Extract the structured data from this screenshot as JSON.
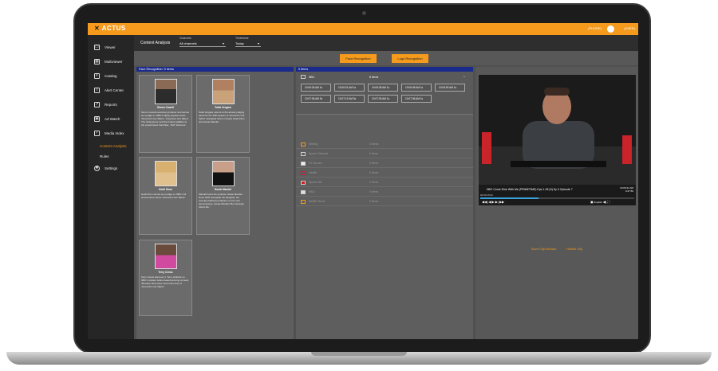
{
  "app": {
    "brand": "ACTUS",
    "phone": "(PHONE)",
    "user": "(USER)"
  },
  "sidebar": {
    "items": [
      {
        "label": "Viewer",
        "icon": "viewer-icon"
      },
      {
        "label": "Multiviewer",
        "icon": "multiviewer-icon"
      },
      {
        "label": "Catalog",
        "icon": "catalog-icon"
      },
      {
        "label": "Alert Center",
        "icon": "bell-icon"
      },
      {
        "label": "Reports",
        "icon": "trend-icon"
      },
      {
        "label": "Ad Watch",
        "icon": "ad-icon"
      },
      {
        "label": "Media Index",
        "icon": "check-icon"
      },
      {
        "label": "Content Analysis",
        "icon": ""
      },
      {
        "label": "Rules",
        "icon": ""
      },
      {
        "label": "Settings",
        "icon": "gear-icon"
      }
    ]
  },
  "header": {
    "title": "Content Analysis",
    "channels_caption": "Channels",
    "channels_value": "All channels",
    "timeframe_caption": "Timeframe",
    "timeframe_value": "Today"
  },
  "buttons": {
    "face": "Face Recognition",
    "logo": "Logo Recognition"
  },
  "faces": {
    "heading": "Face Recognition: 5 items",
    "cards": [
      {
        "name": "Simon Cowell",
        "desc": "Simon Cowell executive producer and serves as a judge on NBC's highly popular series 'America's Got Talent,' 'America's Got Talent: The Champions' and the hottest addition to the powerhouse franchise, 'AGT: Extreme'."
      },
      {
        "name": "Sofía Vergara",
        "desc": "Sofia Vergara returns to the all-star judging panel for the 16th season of 'America's Got Talent' alongside Simon Cowell, Heidi Klum and Howie Mandel."
      },
      {
        "name": "Heidi Klum",
        "desc": "Heidi Klum serves as a judge on NBC's hit summertime series 'America's Got Talent'."
      },
      {
        "name": "Howie Mandel",
        "desc": "Mandel hosts the podcast 'Howie Mandel Does Stuff' alongside his daughter. He recently finished production on his new documentary, 'Howie Mandel: But, Enough About Me.'"
      },
      {
        "name": "Terry Crews",
        "desc": "Terry Crews stars as Lt. Terry Jeffords on NBC's Golden Globe Award-winning comedy 'Brooklyn Nine-Nine' and is the host of 'America's Got Talent'."
      }
    ]
  },
  "networks": {
    "heading": "9 items",
    "main": {
      "label": "NBC",
      "count": "8 items"
    },
    "timestamps": [
      "10:06:26 AM 1s",
      "10:06:31 AM 1s",
      "10:06:35 AM 1s",
      "10:06:45 AM 1s",
      "10:06:53 AM 1s",
      "10:07:06 AM 3s",
      "10:07:12 AM 3s",
      "10:07:26 AM 1s",
      "10:07:36 AM 1s"
    ],
    "rows": [
      {
        "label": "Weekly",
        "count": "0 items"
      },
      {
        "label": "Sports Channel",
        "count": "0 items"
      },
      {
        "label": "FX Movies",
        "count": "0 items"
      },
      {
        "label": "Health",
        "count": "0 items"
      },
      {
        "label": "Sports HD",
        "count": "0 items"
      },
      {
        "label": "HBO",
        "count": "0 items"
      },
      {
        "label": "WGBP News",
        "count": "0 items"
      }
    ]
  },
  "player": {
    "title": "NBC  Come Dine With Me (PRIMETIME) Eps 1-28 (S) Ep 3 Episode 7",
    "time_top": "10:06:31 AM",
    "time_bottom": "0:27:50",
    "time_left": "00:00:15.00",
    "english": "English",
    "progress": 0.38,
    "links": [
      "Save Clip Browse",
      "Hotlink Clip"
    ]
  },
  "colors": {
    "accent": "#f59a1c",
    "heading_blue": "#1a2a8a"
  }
}
